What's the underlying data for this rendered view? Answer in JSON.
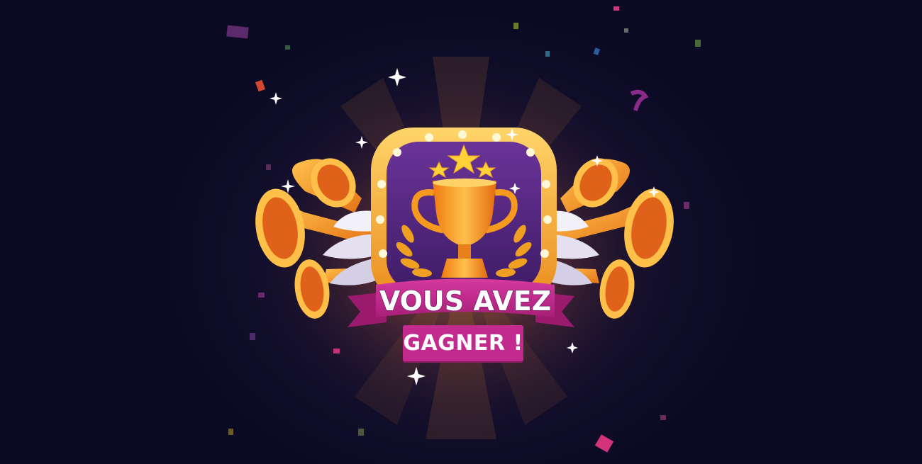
{
  "banner": {
    "title": "VOUS AVEZ",
    "subtitle": "GAGNER !"
  },
  "colors": {
    "background": "#0b0a24",
    "badge_frame": "#f6b23a",
    "badge_inner": "#5b2a86",
    "trophy": "#f59a1e",
    "ribbon": "#c32a8e",
    "subtitle_box": "#c32a8e"
  },
  "icons": [
    "trophy-icon",
    "star-icon",
    "horn-icon",
    "wing-icon",
    "laurel-icon",
    "sparkle-icon",
    "confetti-icon"
  ]
}
